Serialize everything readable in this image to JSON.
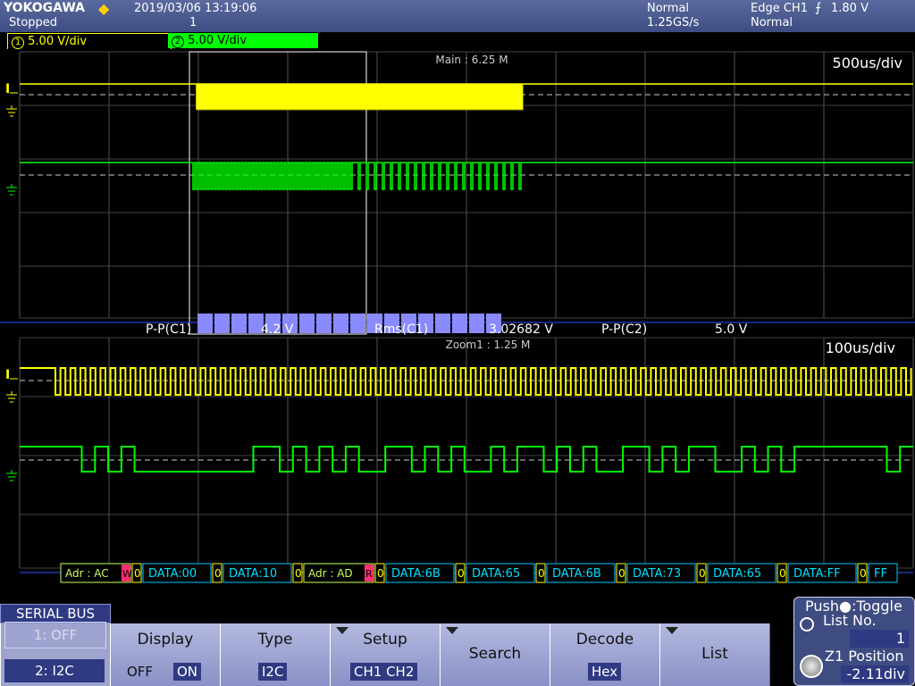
{
  "header": {
    "brand": "YOKOGAWA",
    "status": "Stopped",
    "datetime": "2019/03/06 13:19:06",
    "acq_count": "1",
    "mode": "Normal",
    "sample_rate": "1.25GS/s",
    "trigger": "Edge CH1",
    "trigger_level": "1.80 V",
    "trigger_mode": "Normal"
  },
  "channels": {
    "ch1": {
      "num": "1",
      "scale": "5.00 V/div",
      "color": "#ffff00"
    },
    "ch2": {
      "num": "2",
      "scale": "5.00 V/div",
      "color": "#00ff00"
    }
  },
  "main": {
    "label": "Main : 6.25 M",
    "timebase": "500us/div"
  },
  "zoom": {
    "label": "Zoom1 : 1.25 M",
    "timebase": "100us/div"
  },
  "measurements": [
    {
      "name": "P-P(C1)",
      "value": "4.2 V"
    },
    {
      "name": "Rms(C1)",
      "value": "3.02682 V"
    },
    {
      "name": "P-P(C2)",
      "value": "5.0 V"
    }
  ],
  "decode": [
    {
      "kind": "addr",
      "text": "Adr : AC",
      "flag": "W"
    },
    {
      "kind": "ack",
      "text": "0"
    },
    {
      "kind": "data",
      "text": "DATA:00"
    },
    {
      "kind": "ack",
      "text": "0"
    },
    {
      "kind": "data",
      "text": "DATA:10"
    },
    {
      "kind": "ack",
      "text": "0"
    },
    {
      "kind": "addr",
      "text": "Adr : AD",
      "flag": "R"
    },
    {
      "kind": "ack",
      "text": "0"
    },
    {
      "kind": "data",
      "text": "DATA:6B"
    },
    {
      "kind": "ack",
      "text": "0"
    },
    {
      "kind": "data",
      "text": "DATA:65"
    },
    {
      "kind": "ack",
      "text": "0"
    },
    {
      "kind": "data",
      "text": "DATA:6B"
    },
    {
      "kind": "ack",
      "text": "0"
    },
    {
      "kind": "data",
      "text": "DATA:73"
    },
    {
      "kind": "ack",
      "text": "0"
    },
    {
      "kind": "data",
      "text": "DATA:65"
    },
    {
      "kind": "ack",
      "text": "0"
    },
    {
      "kind": "data",
      "text": "DATA:FF"
    },
    {
      "kind": "ack",
      "text": "0"
    },
    {
      "kind": "data",
      "text": "FF"
    }
  ],
  "menu": {
    "title": "SERIAL BUS",
    "bus_off": "1: OFF",
    "bus_i2c": "2: I2C",
    "display_label": "Display",
    "display_off": "OFF",
    "display_on": "ON",
    "type_label": "Type",
    "type_value": "I2C",
    "setup_label": "Setup",
    "setup_value": "CH1 CH2",
    "search_label": "Search",
    "decode_label": "Decode",
    "decode_value": "Hex",
    "list_label": "List"
  },
  "knob": {
    "push_toggle": "Push●:Toggle",
    "list_no_label": "List No.",
    "list_no_value": "1",
    "position_label": "Z1 Position",
    "position_value": "-2.11div"
  }
}
